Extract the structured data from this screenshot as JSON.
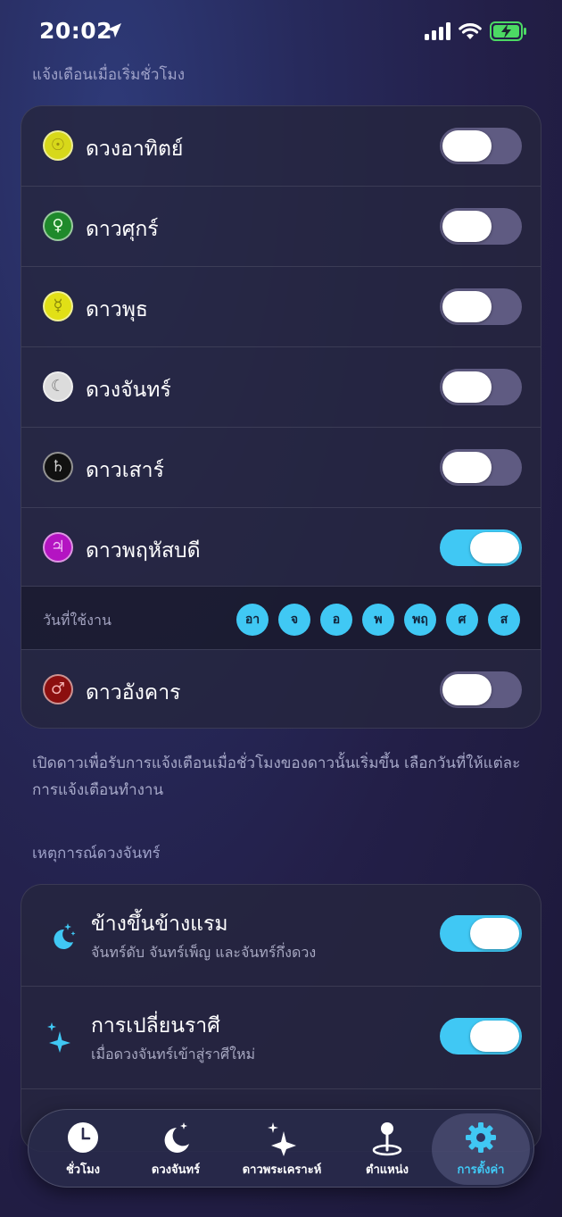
{
  "status": {
    "time": "20:02"
  },
  "hour_section": {
    "title": "แจ้งเตือนเมื่อเริ่มชั่วโมง",
    "planets": [
      {
        "label": "ดวงอาทิตย์",
        "symbol": "☉",
        "color": "#d7d81a",
        "enabled": false
      },
      {
        "label": "ดาวศุกร์",
        "symbol": "♀",
        "color": "#1f8a2b",
        "enabled": false
      },
      {
        "label": "ดาวพุธ",
        "symbol": "☿",
        "color": "#e1e016",
        "enabled": false
      },
      {
        "label": "ดวงจันทร์",
        "symbol": "☾",
        "color": "#dcdcdc",
        "enabled": false
      },
      {
        "label": "ดาวเสาร์",
        "symbol": "♄",
        "color": "#111111",
        "enabled": false
      },
      {
        "label": "ดาวพฤหัสบดี",
        "symbol": "♃",
        "color": "#b414c2",
        "enabled": true
      }
    ],
    "days_label": "วันที่ใช้งาน",
    "days": [
      "อา",
      "จ",
      "อ",
      "พ",
      "พฤ",
      "ศ",
      "ส"
    ],
    "mars": {
      "label": "ดาวอังคาร",
      "symbol": "♂",
      "color": "#8c0f0f",
      "enabled": false
    },
    "footnote": "เปิดดาวเพื่อรับการแจ้งเตือนเมื่อชั่วโมงของดาวนั้นเริ่มขึ้น เลือกวันที่ให้แต่ละการแจ้งเตือนทำงาน"
  },
  "moon_section": {
    "title": "เหตุการณ์ดวงจันทร์",
    "events": [
      {
        "title": "ข้างขึ้นข้างแรม",
        "subtitle": "จันทร์ดับ จันทร์เพ็ญ และจันทร์กึ่งดวง",
        "icon": "moon-stars-icon",
        "enabled": true
      },
      {
        "title": "การเปลี่ยนราศี",
        "subtitle": "เมื่อดวงจันทร์เข้าสู่ราศีใหม่",
        "icon": "sparkles-icon",
        "enabled": true
      }
    ]
  },
  "tabbar": {
    "tabs": [
      {
        "label": "ชั่วโมง",
        "icon": "clock-icon"
      },
      {
        "label": "ดวงจันทร์",
        "icon": "moon-stars-icon"
      },
      {
        "label": "ดาวพระเคราะห์",
        "icon": "sparkles-icon"
      },
      {
        "label": "ตำแหน่ง",
        "icon": "location-pin-icon"
      },
      {
        "label": "การตั้งค่า",
        "icon": "gear-icon",
        "active": true
      }
    ]
  },
  "colors": {
    "accent": "#40c8f4",
    "toggle_off": "#5f5b82"
  }
}
